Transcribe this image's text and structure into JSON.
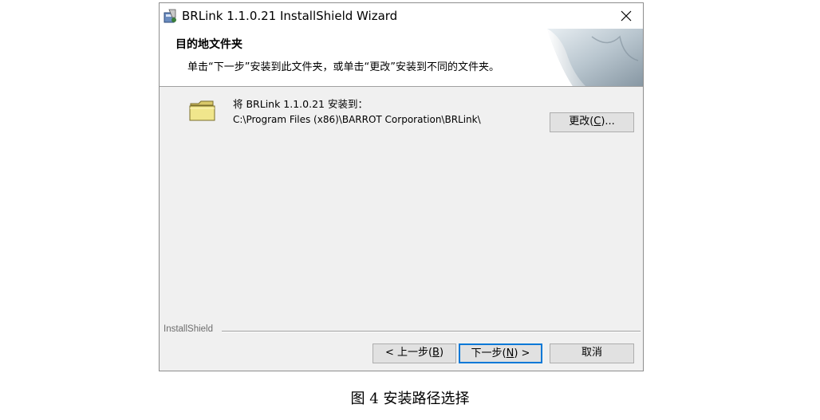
{
  "window": {
    "title": "BRLink 1.1.0.21 InstallShield Wizard",
    "close_glyph": "✕"
  },
  "banner": {
    "title": "目的地文件夹",
    "description": "单击“下一步”安装到此文件夹，或单击“更改”安装到不同的文件夹。"
  },
  "destination": {
    "install_to_label": "将 BRLink 1.1.0.21 安装到：",
    "path": "C:\\Program Files (x86)\\BARROT Corporation\\BRLink\\",
    "change_button": {
      "label": "更改(",
      "accel": "C",
      "suffix": ")..."
    }
  },
  "footer": {
    "brand": "InstallShield",
    "back_button": {
      "label": "< 上一步(",
      "accel": "B",
      "suffix": ")"
    },
    "next_button": {
      "label": "下一步(",
      "accel": "N",
      "suffix": ") >"
    },
    "cancel_button": {
      "label": "取消"
    }
  },
  "caption": "图  4 安装路径选择",
  "icons": {
    "app": "installer-icon",
    "folder": "folder-icon",
    "close": "close-icon"
  },
  "colors": {
    "dialog_bg": "#f0f0f0",
    "default_button_border": "#0078d7",
    "folder_fill": "#f0e68c"
  }
}
